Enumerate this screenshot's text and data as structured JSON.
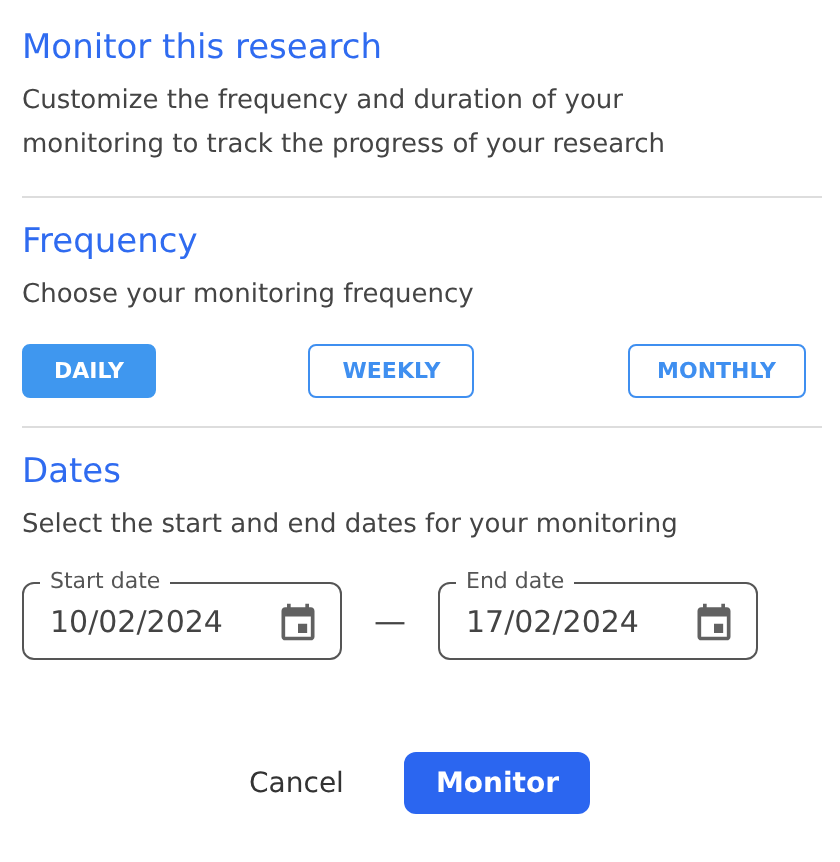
{
  "header": {
    "title": "Monitor this research",
    "description": "Customize the frequency and duration of your monitoring to track the progress of your research"
  },
  "frequency": {
    "title": "Frequency",
    "description": "Choose your monitoring frequency",
    "options": [
      {
        "label": "DAILY",
        "selected": true
      },
      {
        "label": "WEEKLY",
        "selected": false
      },
      {
        "label": "MONTHLY",
        "selected": false
      }
    ]
  },
  "dates": {
    "title": "Dates",
    "description": "Select the start and end dates for your monitoring",
    "separator": "—",
    "fields": [
      {
        "label": "Start date",
        "value": "10/02/2024"
      },
      {
        "label": "End date",
        "value": "17/02/2024"
      }
    ]
  },
  "actions": {
    "cancel": "Cancel",
    "confirm": "Monitor"
  }
}
